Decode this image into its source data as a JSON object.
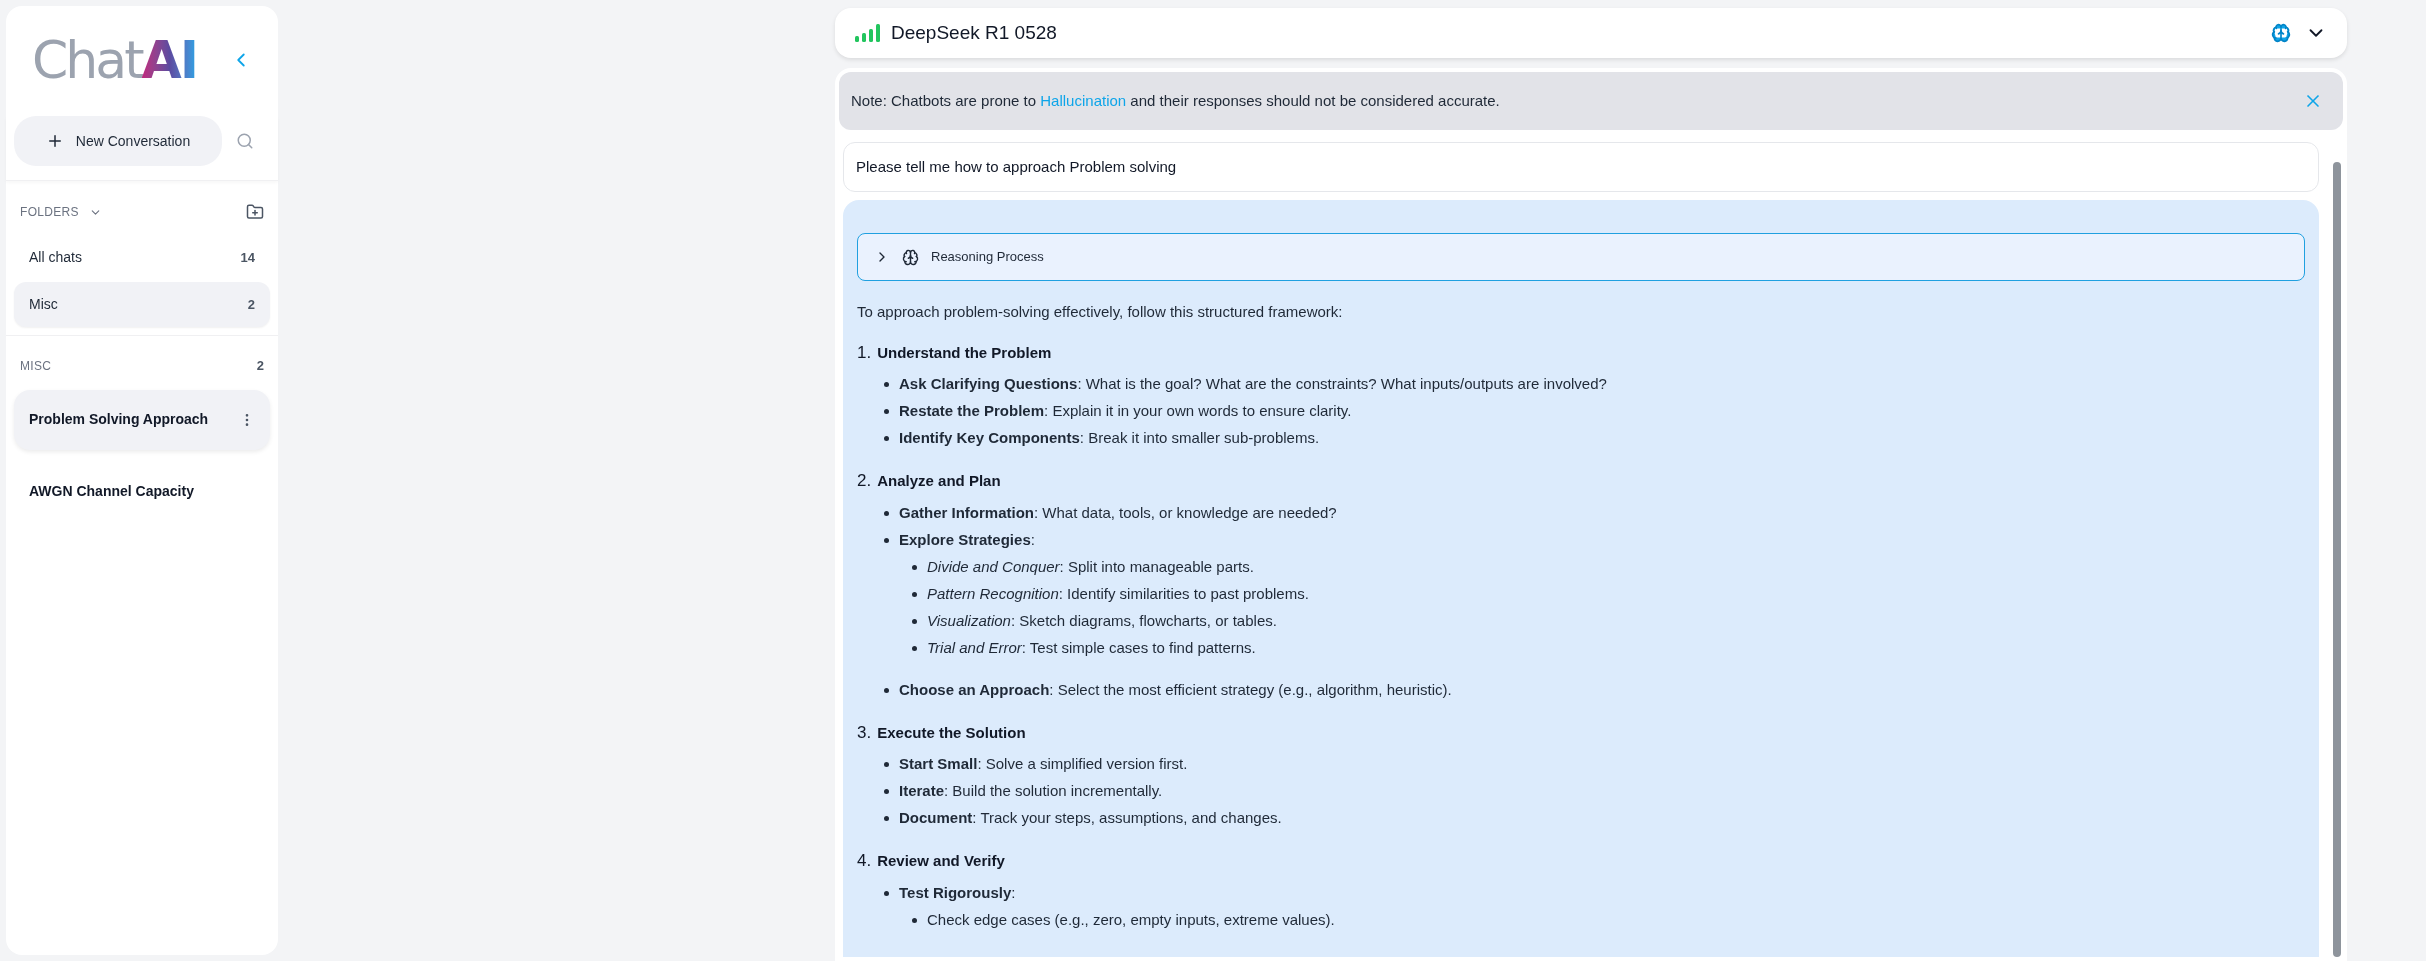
{
  "sidebar": {
    "logo": {
      "word": "Chat",
      "accent": "AI"
    },
    "new_button": "New Conversation",
    "folders_header": {
      "label": "FOLDERS",
      "expanded": true
    },
    "folders": [
      {
        "label": "All chats",
        "count": "14",
        "selected": false
      },
      {
        "label": "Misc",
        "count": "2",
        "selected": true
      }
    ],
    "group": {
      "label": "MISC",
      "count": "2"
    },
    "chats": [
      {
        "title": "Problem Solving Approach",
        "selected": true
      },
      {
        "title": "AWGN Channel Capacity",
        "selected": false
      }
    ]
  },
  "header": {
    "model": "DeepSeek R1 0528"
  },
  "note": {
    "before": "Note: Chatbots are prone to ",
    "link": "Hallucination",
    "after": " and their responses should not be considered accurate."
  },
  "user_message": "Please tell me how to approach Problem solving",
  "response": {
    "reasoning": {
      "label": "Reasoning Process",
      "expanded": false
    },
    "intro": "To approach problem-solving effectively, follow this structured framework:",
    "sections": [
      {
        "number": "1.",
        "title": "Understand the Problem",
        "items": [
          {
            "text": "**Ask Clarifying Questions**: What is the goal? What are the constraints? What inputs/outputs are involved?"
          },
          {
            "text": "**Restate the Problem**: Explain it in your own words to ensure clarity."
          },
          {
            "text": "**Identify Key Components**: Break it into smaller sub-problems."
          }
        ]
      },
      {
        "number": "2.",
        "title": "Analyze and Plan",
        "items": [
          {
            "text": "**Gather Information**: What data, tools, or knowledge are needed?"
          },
          {
            "text": "**Explore Strategies**:",
            "children": [
              {
                "text": "*Divide and Conquer*: Split into manageable parts."
              },
              {
                "text": "*Pattern Recognition*: Identify similarities to past problems."
              },
              {
                "text": "*Visualization*: Sketch diagrams, flowcharts, or tables."
              },
              {
                "text": "*Trial and Error*: Test simple cases to find patterns."
              }
            ]
          },
          {
            "text": "**Choose an Approach**: Select the most efficient strategy (e.g., algorithm, heuristic)."
          }
        ]
      },
      {
        "number": "3.",
        "title": "Execute the Solution",
        "items": [
          {
            "text": "**Start Small**: Solve a simplified version first."
          },
          {
            "text": "**Iterate**: Build the solution incrementally."
          },
          {
            "text": "**Document**: Track your steps, assumptions, and changes."
          }
        ]
      },
      {
        "number": "4.",
        "title": "Review and Verify",
        "items": [
          {
            "text": "**Test Rigorously**:",
            "children": [
              {
                "text": "Check edge cases (e.g., zero, empty inputs, extreme values)."
              }
            ]
          }
        ]
      }
    ]
  }
}
